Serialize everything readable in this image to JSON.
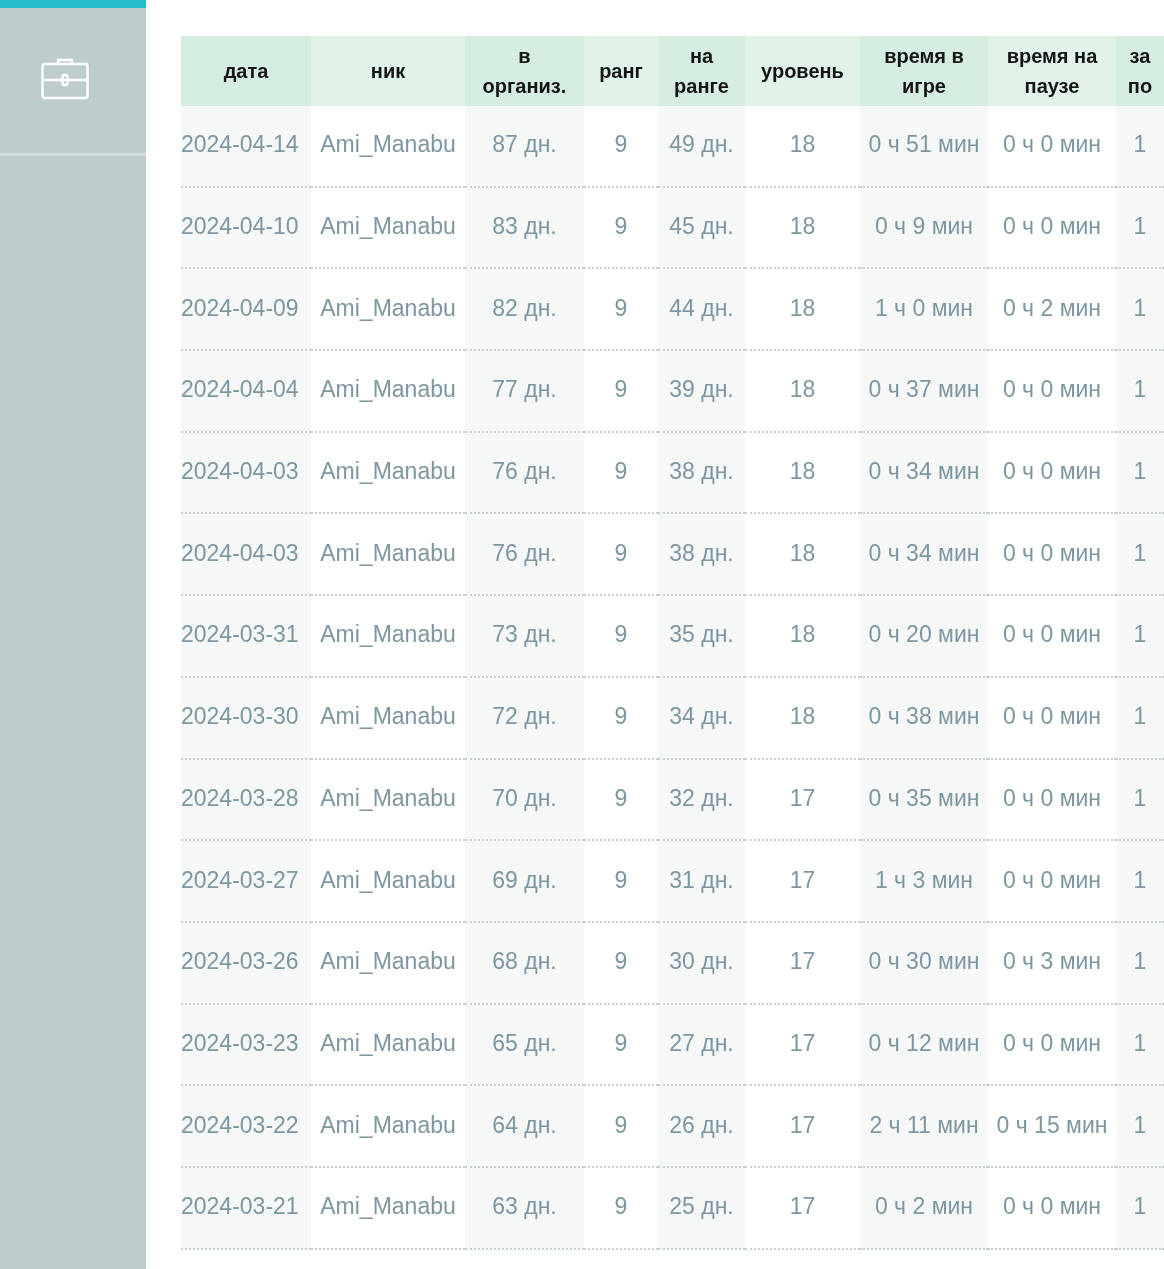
{
  "table": {
    "columns": [
      "дата",
      "ник",
      "в\nорганиз.",
      "ранг",
      "на\nранге",
      "уровень",
      "время в\nигре",
      "время на\nпаузе",
      "за\nпо"
    ],
    "rows": [
      [
        "2024-04-14",
        "Ami_Manabu",
        "87 дн.",
        "9",
        "49 дн.",
        "18",
        "0 ч 51 мин",
        "0 ч 0 мин",
        "1"
      ],
      [
        "2024-04-10",
        "Ami_Manabu",
        "83 дн.",
        "9",
        "45 дн.",
        "18",
        "0 ч 9 мин",
        "0 ч 0 мин",
        "1"
      ],
      [
        "2024-04-09",
        "Ami_Manabu",
        "82 дн.",
        "9",
        "44 дн.",
        "18",
        "1 ч 0 мин",
        "0 ч 2 мин",
        "1"
      ],
      [
        "2024-04-04",
        "Ami_Manabu",
        "77 дн.",
        "9",
        "39 дн.",
        "18",
        "0 ч 37 мин",
        "0 ч 0 мин",
        "1"
      ],
      [
        "2024-04-03",
        "Ami_Manabu",
        "76 дн.",
        "9",
        "38 дн.",
        "18",
        "0 ч 34 мин",
        "0 ч 0 мин",
        "1"
      ],
      [
        "2024-04-03",
        "Ami_Manabu",
        "76 дн.",
        "9",
        "38 дн.",
        "18",
        "0 ч 34 мин",
        "0 ч 0 мин",
        "1"
      ],
      [
        "2024-03-31",
        "Ami_Manabu",
        "73 дн.",
        "9",
        "35 дн.",
        "18",
        "0 ч 20 мин",
        "0 ч 0 мин",
        "1"
      ],
      [
        "2024-03-30",
        "Ami_Manabu",
        "72 дн.",
        "9",
        "34 дн.",
        "18",
        "0 ч 38 мин",
        "0 ч 0 мин",
        "1"
      ],
      [
        "2024-03-28",
        "Ami_Manabu",
        "70 дн.",
        "9",
        "32 дн.",
        "17",
        "0 ч 35 мин",
        "0 ч 0 мин",
        "1"
      ],
      [
        "2024-03-27",
        "Ami_Manabu",
        "69 дн.",
        "9",
        "31 дн.",
        "17",
        "1 ч 3 мин",
        "0 ч 0 мин",
        "1"
      ],
      [
        "2024-03-26",
        "Ami_Manabu",
        "68 дн.",
        "9",
        "30 дн.",
        "17",
        "0 ч 30 мин",
        "0 ч 3 мин",
        "1"
      ],
      [
        "2024-03-23",
        "Ami_Manabu",
        "65 дн.",
        "9",
        "27 дн.",
        "17",
        "0 ч 12 мин",
        "0 ч 0 мин",
        "1"
      ],
      [
        "2024-03-22",
        "Ami_Manabu",
        "64 дн.",
        "9",
        "26 дн.",
        "17",
        "2 ч 11 мин",
        "0 ч 15 мин",
        "1"
      ],
      [
        "2024-03-21",
        "Ami_Manabu",
        "63 дн.",
        "9",
        "25 дн.",
        "17",
        "0 ч 2 мин",
        "0 ч 0 мин",
        "1"
      ]
    ]
  }
}
